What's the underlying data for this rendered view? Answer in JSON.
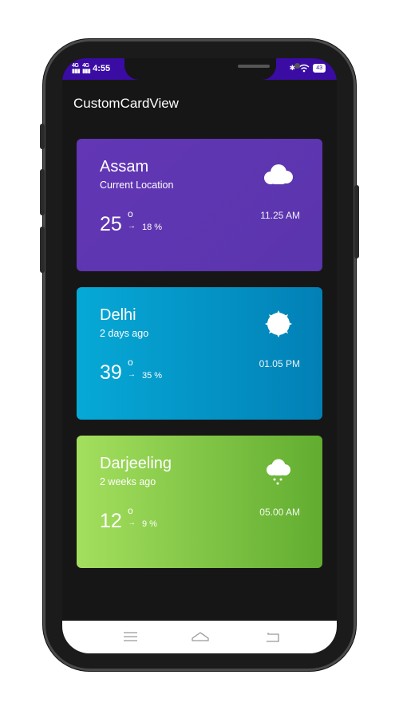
{
  "status": {
    "network_1": "4G",
    "network_2": "4G",
    "time": "4:55",
    "battery": "43"
  },
  "app": {
    "title": "CustomCardView"
  },
  "cards": [
    {
      "city": "Assam",
      "subtitle": "Current Location",
      "temp": "25",
      "degree": "o",
      "arrow": "→",
      "humidity": "18 %",
      "time": "11.25 AM",
      "icon": "cloud-icon",
      "colors": [
        "#6236b5",
        "#5a35ad"
      ]
    },
    {
      "city": "Delhi",
      "subtitle": "2 days ago",
      "temp": "39",
      "degree": "o",
      "arrow": "→",
      "humidity": "35 %",
      "time": "01.05 PM",
      "icon": "sun-icon",
      "colors": [
        "#06a9d6",
        "#0280b6"
      ]
    },
    {
      "city": "Darjeeling",
      "subtitle": "2 weeks ago",
      "temp": "12",
      "degree": "o",
      "arrow": "→",
      "humidity": "9 %",
      "time": "05.00 AM",
      "icon": "rain-cloud-icon",
      "colors": [
        "#a4df5e",
        "#61ad30"
      ]
    }
  ],
  "navbar": {
    "icons": [
      "menu-icon",
      "home-icon",
      "back-icon"
    ]
  },
  "colors": {
    "status_bar": "#3a0ca3",
    "background": "#161616"
  }
}
